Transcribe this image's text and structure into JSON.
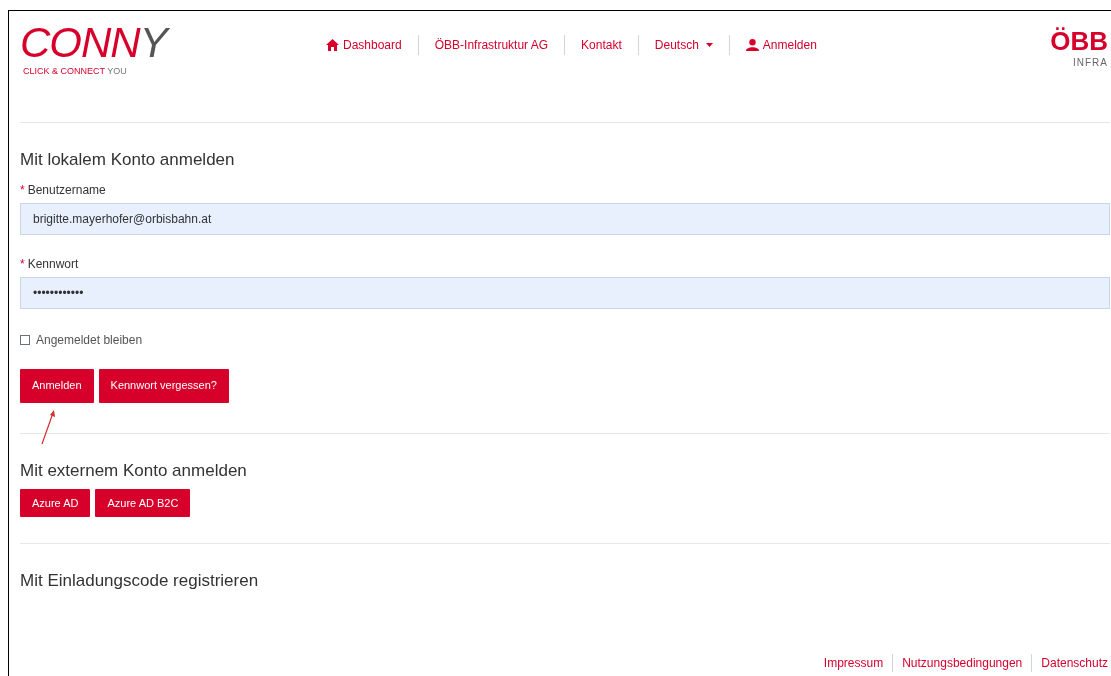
{
  "header": {
    "logo": {
      "red": "CONN",
      "dark": "Y",
      "tagline_red": "CLICK & CONNECT",
      "tagline_dark": "YOU"
    },
    "nav": [
      {
        "kind": "home",
        "label": "Dashboard"
      },
      {
        "kind": "plain",
        "label": "ÖBB-Infrastruktur AG"
      },
      {
        "kind": "plain",
        "label": "Kontakt"
      },
      {
        "kind": "dropdown",
        "label": "Deutsch"
      },
      {
        "kind": "user",
        "label": "Anmelden"
      }
    ],
    "brand": {
      "mark": "ÖBB",
      "sub": "INFRA"
    }
  },
  "local_login": {
    "title": "Mit lokalem Konto anmelden",
    "fields": [
      {
        "label": "Benutzername",
        "required": true,
        "required_mark": "*",
        "value": "brigitte.mayerhofer@orbisbahn.at"
      },
      {
        "label": "Kennwort",
        "required": true,
        "required_mark": "*",
        "value": "••••••••••••"
      }
    ],
    "remember": {
      "label": "Angemeldet bleiben",
      "checked": false
    },
    "buttons": [
      "Anmelden",
      "Kennwort vergessen?"
    ]
  },
  "external_login": {
    "title": "Mit externem Konto anmelden",
    "buttons": [
      "Azure AD",
      "Azure AD B2C"
    ]
  },
  "register": {
    "title": "Mit Einladungscode registrieren"
  },
  "footer": [
    "Impressum",
    "Nutzungsbedingungen",
    "Datenschutz"
  ]
}
